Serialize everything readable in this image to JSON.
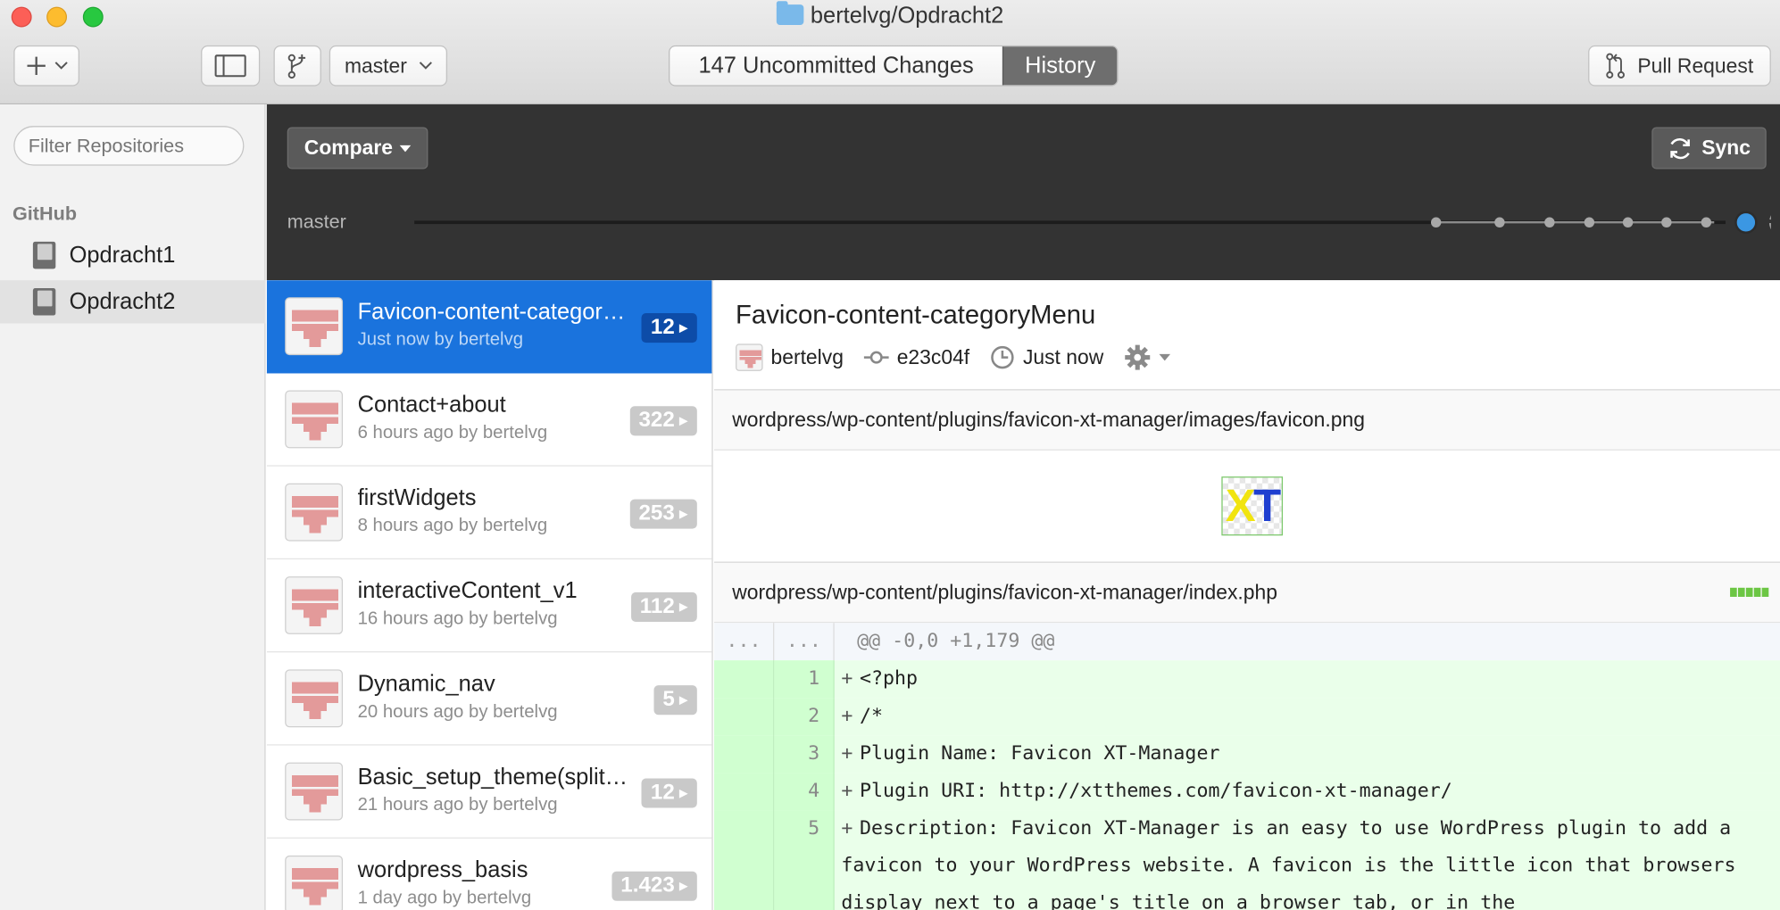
{
  "window": {
    "title": "bertelvg/Opdracht2"
  },
  "toolbar": {
    "branch": "master",
    "uncommitted": "147 Uncommitted Changes",
    "history": "History",
    "pull_request": "Pull Request"
  },
  "sidebar": {
    "filter_placeholder": "Filter Repositories",
    "section": "GitHub",
    "repos": [
      {
        "label": "Opdracht1"
      },
      {
        "label": "Opdracht2"
      }
    ]
  },
  "timeline": {
    "compare": "Compare",
    "sync": "Sync",
    "branch": "master"
  },
  "commits": [
    {
      "title": "Favicon-content-categor…",
      "sub": "Just now by bertelvg",
      "count": "12"
    },
    {
      "title": "Contact+about",
      "sub": "6 hours ago by bertelvg",
      "count": "322"
    },
    {
      "title": "firstWidgets",
      "sub": "8 hours ago by bertelvg",
      "count": "253"
    },
    {
      "title": "interactiveContent_v1",
      "sub": "16 hours ago by bertelvg",
      "count": "112"
    },
    {
      "title": "Dynamic_nav",
      "sub": "20 hours ago by bertelvg",
      "count": "5"
    },
    {
      "title": "Basic_setup_theme(split…",
      "sub": "21 hours ago by bertelvg",
      "count": "12"
    },
    {
      "title": "wordpress_basis",
      "sub": "1 day ago by bertelvg",
      "count": "1.423"
    }
  ],
  "detail": {
    "title": "Favicon-content-categoryMenu",
    "author": "bertelvg",
    "sha": "e23c04f",
    "time": "Just now",
    "files": [
      "wordpress/wp-content/plugins/favicon-xt-manager/images/favicon.png",
      "wordpress/wp-content/plugins/favicon-xt-manager/index.php"
    ],
    "image_text_x": "X",
    "image_text_t": "T",
    "diff": {
      "gutter_old": "...",
      "gutter_new": "...",
      "hunk": "@@ -0,0 +1,179 @@",
      "lines": [
        {
          "n": "1",
          "code": "<?php"
        },
        {
          "n": "2",
          "code": "/*"
        },
        {
          "n": "3",
          "code": "Plugin Name: Favicon XT-Manager"
        },
        {
          "n": "4",
          "code": "Plugin URI: http://xtthemes.com/favicon-xt-manager/"
        },
        {
          "n": "5",
          "code": "Description: Favicon XT-Manager is an easy to use WordPress plugin to add a favicon to your WordPress website. A favicon is the little icon that browsers display next to a page's title on a browser tab, or in the"
        }
      ]
    }
  },
  "colors": {
    "selected": "#1a73dd",
    "accent": "#3b97e3",
    "added": "#eaffea"
  }
}
